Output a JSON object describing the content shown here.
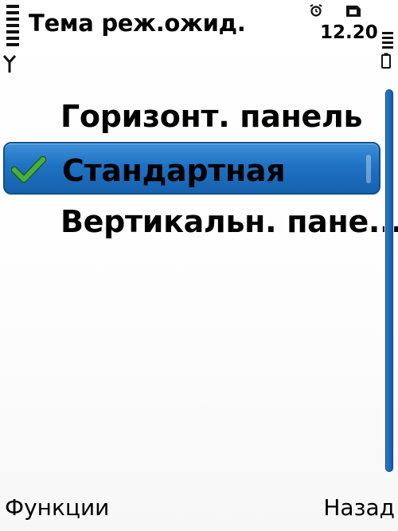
{
  "status": {
    "title": "Тема реж.ожид.",
    "time": "12.20",
    "icons": [
      "signal-strength-icon",
      "antenna-icon",
      "alarm-icon",
      "sim-card-icon",
      "battery-level-icon",
      "battery-icon"
    ]
  },
  "list": {
    "items": [
      {
        "label": "Горизонт. панель",
        "selected": false,
        "checked": false
      },
      {
        "label": "Стандартная",
        "selected": true,
        "checked": true,
        "check_icon": "checkmark-icon"
      },
      {
        "label": "Вертикальн. пане...",
        "selected": false,
        "checked": false
      }
    ]
  },
  "softkeys": {
    "left": "Функции",
    "right": "Назад"
  },
  "colors": {
    "highlight": "#1f72c3",
    "highlight_border": "#0d4f93",
    "check": "#3fa33a",
    "scrollbar": "#1b67b5",
    "background": "#ffffff",
    "text": "#000000"
  }
}
